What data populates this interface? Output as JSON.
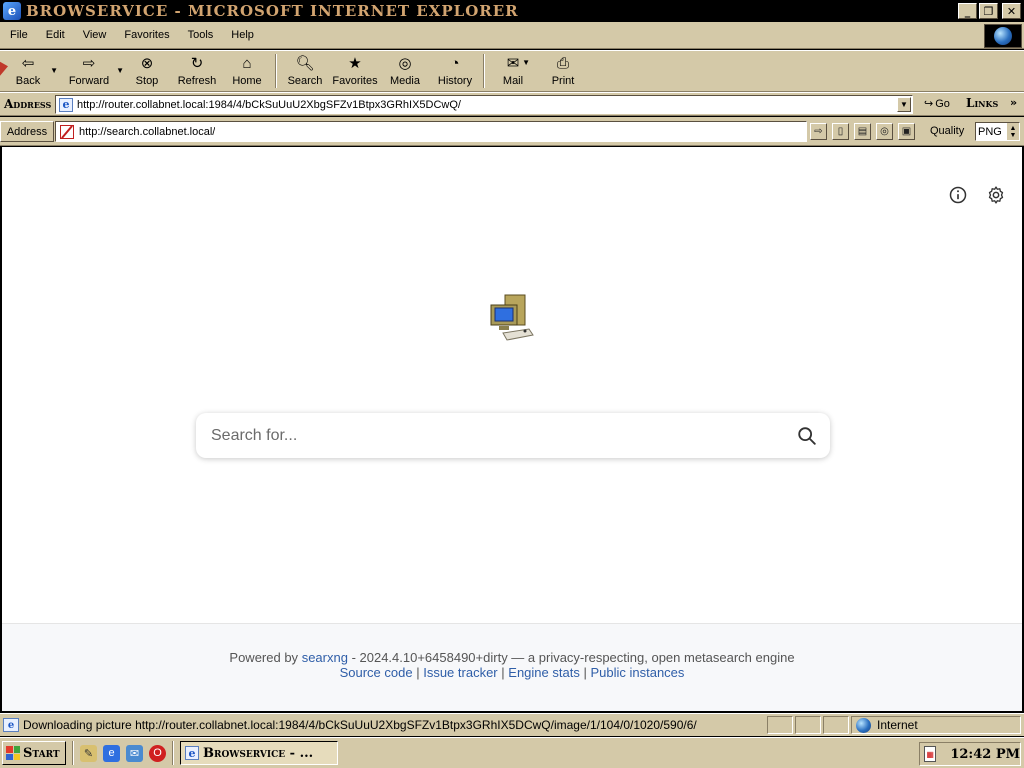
{
  "window": {
    "title": "Browservice - Microsoft Internet Explorer",
    "controls": [
      "_",
      "❐",
      "✕"
    ]
  },
  "menu": [
    "File",
    "Edit",
    "View",
    "Favorites",
    "Tools",
    "Help"
  ],
  "toolbar": {
    "back": "Back",
    "forward": "Forward",
    "stop": "Stop",
    "refresh": "Refresh",
    "home": "Home",
    "search": "Search",
    "favorites": "Favorites",
    "media": "Media",
    "history": "History",
    "mail": "Mail",
    "print": "Print"
  },
  "address_bar": {
    "label": "Address",
    "url": "http://router.collabnet.local:1984/4/bCkSuUuU2XbgSFZv1Btpx3GRhIX5DCwQ/",
    "go_label": "Go",
    "links_label": "Links",
    "links_chevron": "»"
  },
  "inner_bar": {
    "label": "Address",
    "url": "http://search.collabnet.local/",
    "quality_label": "Quality",
    "quality_value": "PNG"
  },
  "page": {
    "search_placeholder": "Search for...",
    "footer": {
      "powered_by": "Powered by",
      "engine_link": "searxng",
      "version_text": "- 2024.4.10+6458490+dirty — a privacy-respecting, open metasearch engine",
      "links": [
        "Source code",
        "Issue tracker",
        "Engine stats",
        "Public instances"
      ],
      "separator": "|"
    }
  },
  "status_bar": {
    "text": "Downloading picture http://router.collabnet.local:1984/4/bCkSuUuU2XbgSFZv1Btpx3GRhIX5DCwQ/image/1/104/0/1020/590/6/",
    "zone": "Internet"
  },
  "taskbar": {
    "start_label": "Start",
    "task_label": "Browservice - ...",
    "clock": "12:42 PM"
  },
  "colors": {
    "chrome": "#d4c9a8",
    "title_text": "#d2a470",
    "link": "#2f5ea8"
  }
}
